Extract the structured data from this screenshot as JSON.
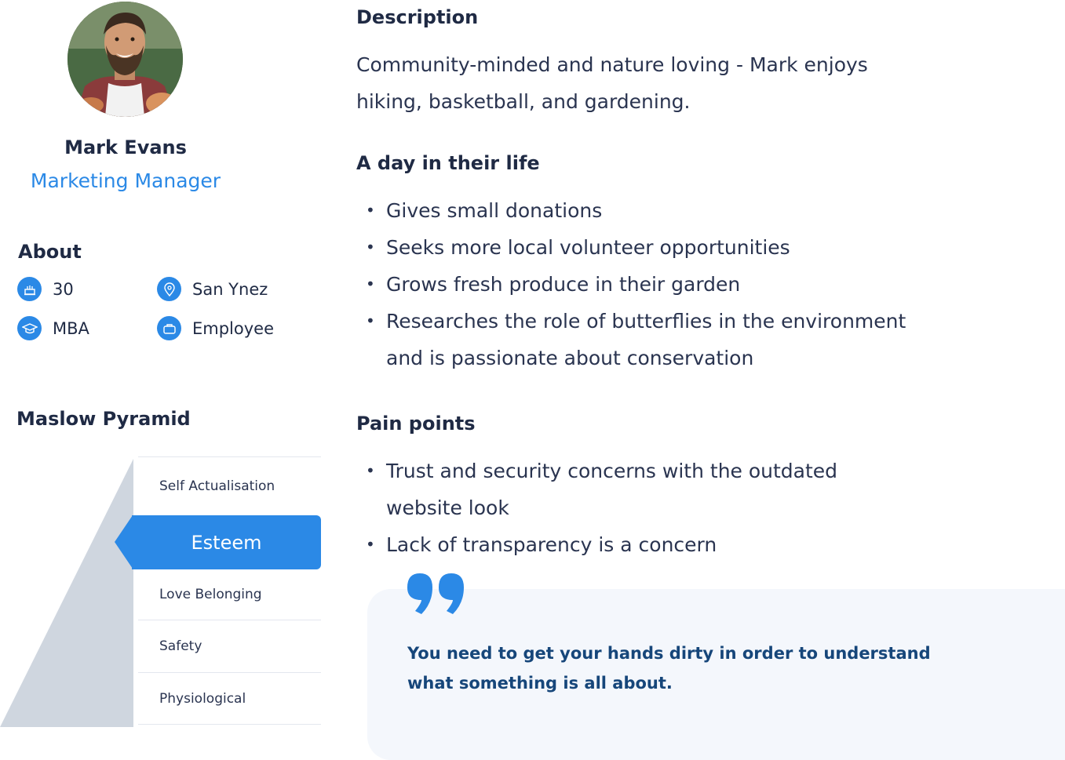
{
  "profile": {
    "avatar_icon": "person-photo-icon",
    "name": "Mark Evans",
    "role": "Marketing Manager"
  },
  "about": {
    "title": "About",
    "items": [
      {
        "icon": "birthday-cake-icon",
        "label": "30"
      },
      {
        "icon": "location-pin-icon",
        "label": "San Ynez"
      },
      {
        "icon": "graduation-cap-icon",
        "label": "MBA"
      },
      {
        "icon": "briefcase-icon",
        "label": "Employee"
      }
    ]
  },
  "maslow": {
    "title": "Maslow Pyramid",
    "levels": [
      {
        "label": "Self Actualisation",
        "active": false
      },
      {
        "label": "Esteem",
        "active": true
      },
      {
        "label": "Love Belonging",
        "active": false
      },
      {
        "label": "Safety",
        "active": false
      },
      {
        "label": "Physiological",
        "active": false
      }
    ]
  },
  "description": {
    "title": "Description",
    "text": "Community-minded and nature loving - Mark enjoys hiking, basketball, and gardening."
  },
  "day_in_life": {
    "title": "A day in their life",
    "items": [
      "Gives small donations",
      "Seeks more local volunteer opportunities",
      "Grows fresh produce in their garden",
      "Researches the role of butterflies in the environment and is passionate about conservation"
    ]
  },
  "pain_points": {
    "title": "Pain points",
    "items": [
      "Trust and security concerns with the outdated website look",
      "Lack of transparency is a concern"
    ]
  },
  "quote": {
    "icon": "quotation-mark-icon",
    "text": "You need to get your hands dirty in order to understand what something is all about."
  },
  "colors": {
    "accent": "#2b89e6",
    "heading": "#1f2a44",
    "quote_text": "#16467a",
    "quote_bg": "#f4f7fc",
    "pyramid": "#cfd6df"
  }
}
